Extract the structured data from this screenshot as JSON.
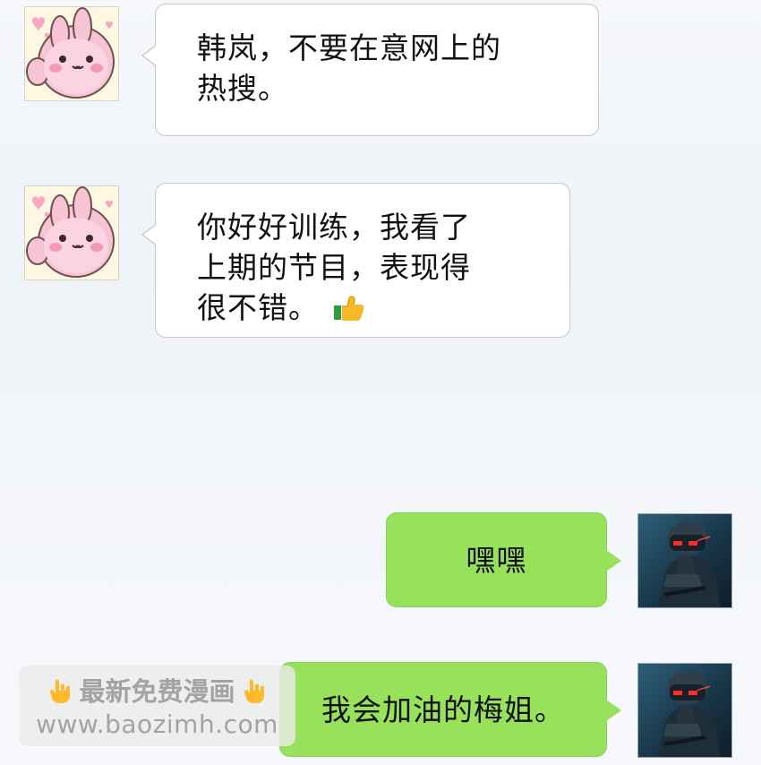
{
  "messages": [
    {
      "side": "left",
      "avatar_icon": "bunny-avatar-icon",
      "lines": [
        "韩岚，不要在意网上的",
        "热搜。"
      ]
    },
    {
      "side": "left",
      "avatar_icon": "bunny-avatar-icon",
      "lines": [
        "你好好训练，我看了",
        "上期的节目，表现得",
        "很不错。"
      ],
      "emoji": "thumbs-up-icon"
    },
    {
      "side": "right",
      "avatar_icon": "soldier-avatar-icon",
      "text": "嘿嘿"
    },
    {
      "side": "right",
      "avatar_icon": "soldier-avatar-icon",
      "text": "我会加油的梅姐。"
    }
  ],
  "watermark": {
    "title": "最新免费漫画",
    "url": "www.baozimh.com",
    "icon": "pointing-hand-icon"
  },
  "colors": {
    "left_bubble": "#ffffff",
    "right_bubble": "#98e15b",
    "watermark_text": "#a3a3a3"
  }
}
